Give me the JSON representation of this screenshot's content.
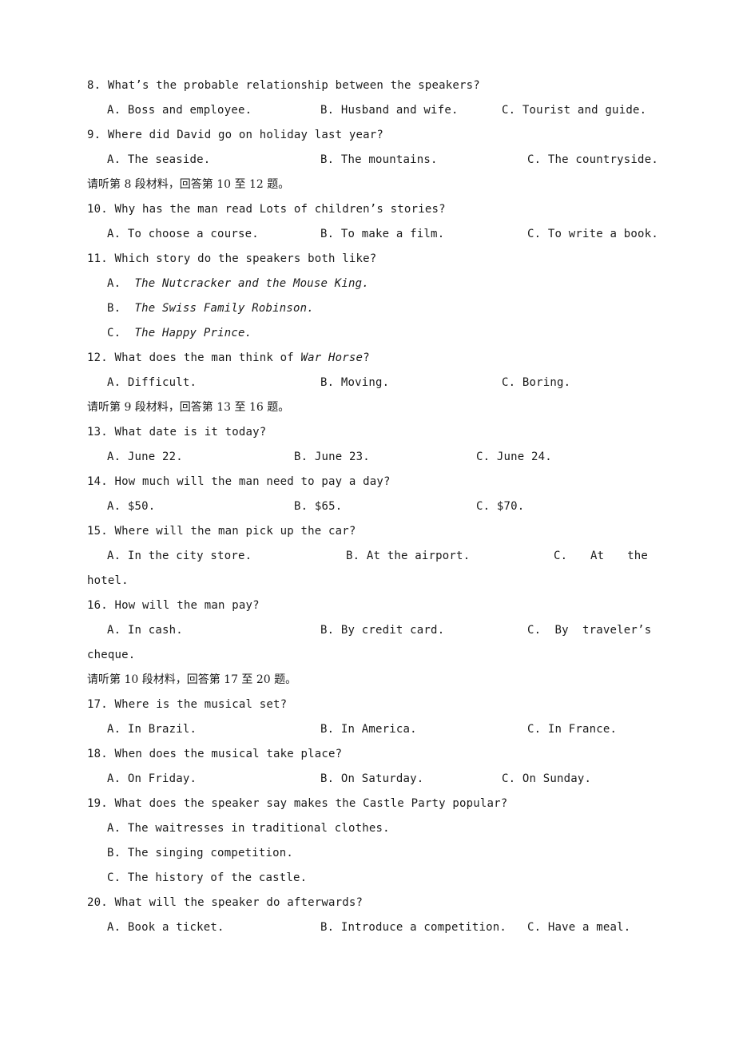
{
  "questions": [
    {
      "num": "8.",
      "text": "What’s the probable relationship between the speakers?",
      "options": [
        "A. Boss and employee.",
        "B. Husband and wife.",
        "C. Tourist and guide."
      ]
    },
    {
      "num": "9.",
      "text": "Where did David go on holiday last year?",
      "options": [
        "A. The seaside.",
        "B. The mountains.",
        "C. The countryside."
      ]
    },
    {
      "num": "10.",
      "text": "Why has the man read Lots of children’s stories?",
      "options": [
        "A. To choose a course.",
        "B. To make a film.",
        "C. To write a book."
      ]
    },
    {
      "num": "11.",
      "text": "Which story do the speakers both like?",
      "options": [
        {
          "letter": "A.",
          "title": "The Nutcracker and the Mouse King."
        },
        {
          "letter": "B.",
          "title": "The Swiss Family Robinson."
        },
        {
          "letter": "C.",
          "title": "The Happy Prince."
        }
      ]
    },
    {
      "num": "12.",
      "text_before": "What does the man think of ",
      "text_italic": "War Horse",
      "text_after": "?",
      "options": [
        "A. Difficult.",
        "B. Moving.",
        "C. Boring."
      ]
    },
    {
      "num": "13.",
      "text": "What date is it today?",
      "options": [
        "A. June 22.",
        "B. June 23.",
        "C. June 24."
      ]
    },
    {
      "num": "14.",
      "text": "How much will the man need to pay a day?",
      "options": [
        "A. $50.",
        "B. $65.",
        "C. $70."
      ]
    },
    {
      "num": "15.",
      "text": "Where will the man pick up the car?",
      "options": [
        "A. In the city store.",
        "B. At the airport.",
        "C.    At    the",
        "hotel."
      ]
    },
    {
      "num": "16.",
      "text": "How will the man pay?",
      "options": [
        "A. In cash.",
        "B. By credit card.",
        "C.  By  traveler’s",
        "cheque."
      ]
    },
    {
      "num": "17.",
      "text": "Where is the musical set?",
      "options": [
        "A. In Brazil.",
        "B. In America.",
        "C. In France."
      ]
    },
    {
      "num": "18.",
      "text": "When does the musical take place?",
      "options": [
        "A. On Friday.",
        "B. On Saturday.",
        "C. On Sunday."
      ]
    },
    {
      "num": "19.",
      "text": "What does the speaker say makes the Castle Party popular?",
      "options": [
        "A. The waitresses in traditional clothes.",
        "B. The singing competition.",
        "C. The history of the castle."
      ]
    },
    {
      "num": "20.",
      "text": "What will the speaker do afterwards?",
      "options": [
        "A. Book a ticket.",
        "B. Introduce a competition.",
        "C. Have a meal."
      ]
    }
  ],
  "sections": {
    "s8": "请听第 8 段材料，回答第 10 至 12 题。",
    "s9": "请听第 9 段材料，回答第 13 至 16 题。",
    "s10": "请听第 10 段材料，回答第 17 至 20 题。"
  }
}
